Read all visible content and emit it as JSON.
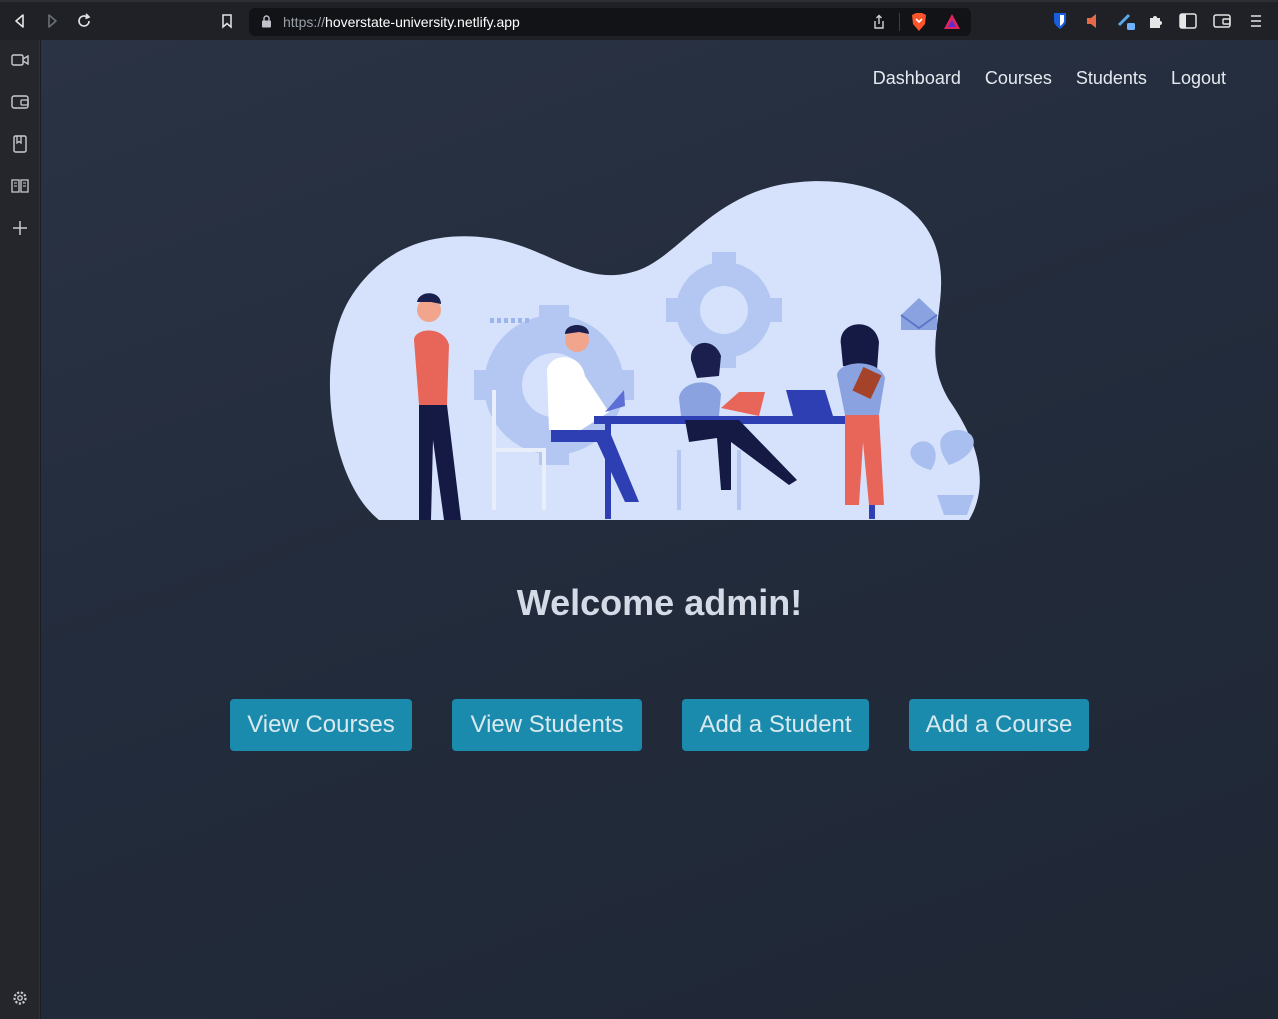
{
  "browser": {
    "url_scheme": "https://",
    "url_host": "hoverstate-university.netlify.app"
  },
  "nav": {
    "links": [
      "Dashboard",
      "Courses",
      "Students",
      "Logout"
    ]
  },
  "main": {
    "welcome": "Welcome admin!",
    "buttons": [
      "View Courses",
      "View Students",
      "Add a Student",
      "Add a Course"
    ]
  },
  "colors": {
    "accent": "#1b8bad",
    "background": "#232c3c",
    "blob": "#d6e2fb"
  }
}
